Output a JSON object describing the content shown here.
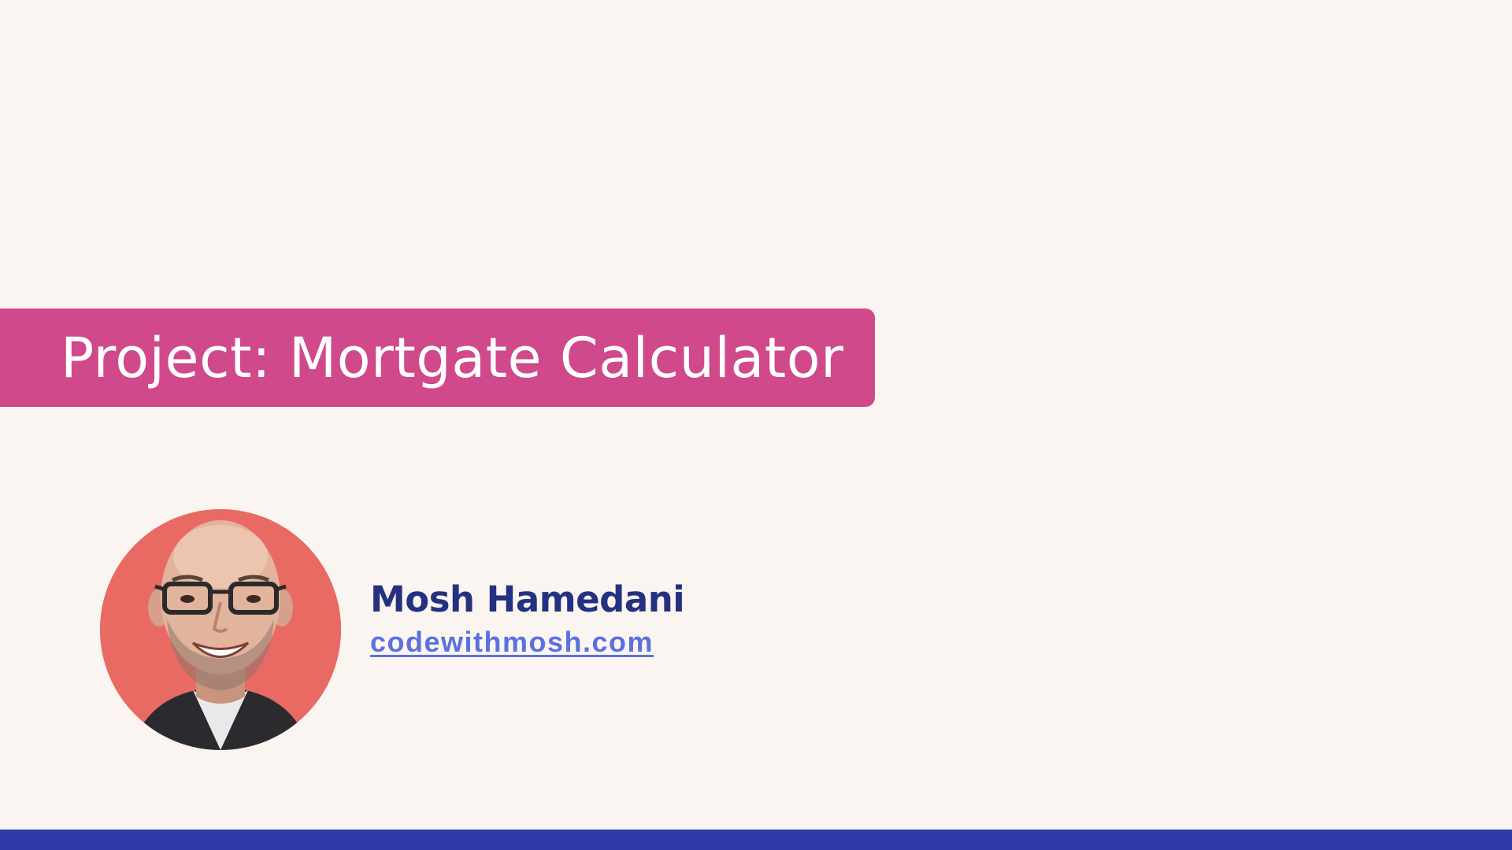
{
  "slide": {
    "title": "Project: Mortgate Calculator",
    "author_name": "Mosh Hamedani",
    "author_link": "codewithmosh.com"
  },
  "colors": {
    "background": "#faf5f0",
    "banner": "#d0498a",
    "author_name": "#243180",
    "author_link": "#5c70df",
    "bottom_bar": "#2f3ba8",
    "avatar_background": "#e86a63"
  },
  "icons": {
    "avatar": "author-photo"
  }
}
